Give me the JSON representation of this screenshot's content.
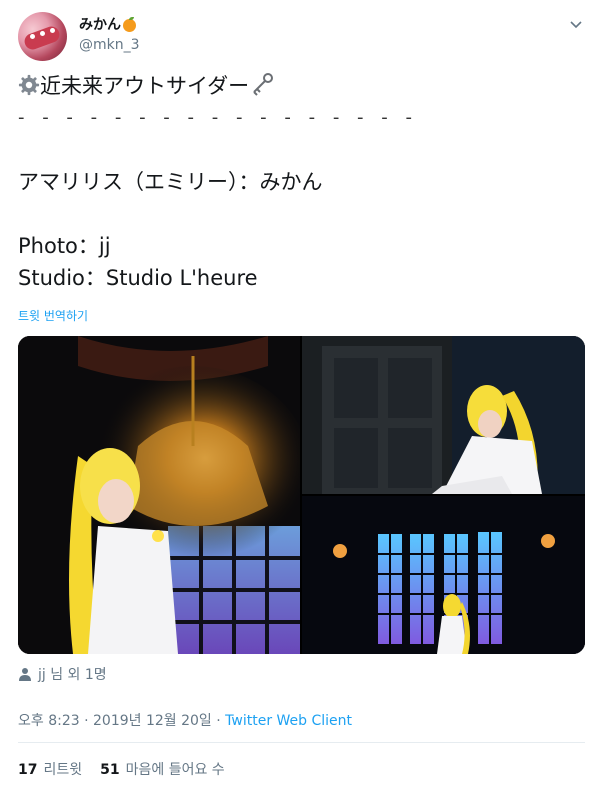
{
  "author": {
    "display_name": "みかん",
    "handle": "@mkn_3",
    "avatar_icon": "avatar",
    "emoji_icon": "orange-emoji-icon"
  },
  "menu_icon": "chevron-down-icon",
  "tweet": {
    "lines": [
      "近未来アウトサイダー",
      "- - - - - - - - - - - - - - - - -",
      "",
      "アマリリス（エミリー）：みかん",
      "",
      "Photo：jj",
      "Studio：Studio L'heure"
    ],
    "translate_label": "트윗 번역하기"
  },
  "media": {
    "count": 3
  },
  "tagged": {
    "label": "jj 님 외 1명"
  },
  "timestamp": {
    "time": "오후 8:23 · 2019년 12월 20일 · ",
    "client": "Twitter Web Client"
  },
  "stats": {
    "retweets_count": "17",
    "retweets_label": "리트윗",
    "likes_count": "51",
    "likes_label": "마음에 들어요 수"
  },
  "colors": {
    "link": "#1da1f2",
    "secondary_text": "#657786",
    "primary_text": "#14171a",
    "divider": "#e6ecf0"
  }
}
